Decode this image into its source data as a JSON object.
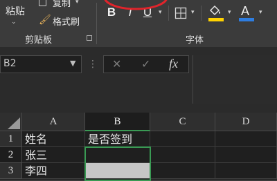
{
  "ribbon": {
    "clipboard": {
      "paste_label": "粘贴",
      "copy_label": "复制",
      "format_painter_label": "格式刷",
      "group_label": "剪贴板"
    },
    "font": {
      "bold_label": "B",
      "italic_label": "I",
      "underline_label": "U",
      "font_color_label": "A",
      "group_label": "字体",
      "fill_color": "#ffd200",
      "font_color": "#2e7de0",
      "highlight_ring_color": "#e0242b"
    }
  },
  "formula_bar": {
    "name_box_value": "B2",
    "cancel_symbol": "✕",
    "enter_symbol": "✓",
    "fx_label": "fx",
    "formula_value": ""
  },
  "sheet": {
    "columns": [
      "A",
      "B",
      "C",
      "D"
    ],
    "rows": [
      "1",
      "2",
      "3"
    ],
    "cells": {
      "A1": "姓名",
      "B1": "是否签到",
      "A2": "张三",
      "A3": "李四"
    },
    "active_cell": "B2",
    "selection_color": "#3a9a54"
  }
}
